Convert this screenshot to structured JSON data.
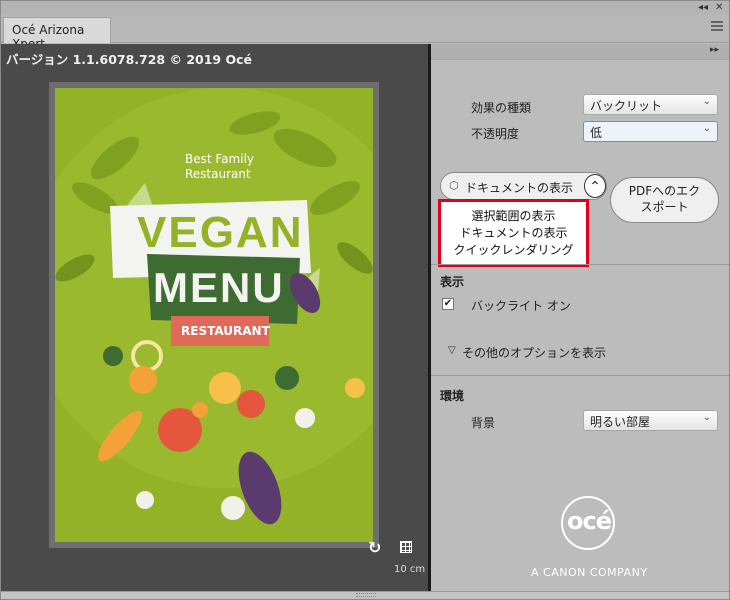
{
  "app": {
    "tab_title": "Océ Arizona Xpert"
  },
  "viewer": {
    "version": "バージョン 1.1.6078.728 © 2019 Océ",
    "scale_label": "10 cm",
    "poster": {
      "line1": "Best Family",
      "line2": "Restaurant",
      "title1": "VEGAN",
      "title2": "MENU",
      "badge": "RESTAURANT"
    }
  },
  "panel": {
    "effect_type_label": "効果の種類",
    "effect_type_value": "バックリット",
    "opacity_label": "不透明度",
    "opacity_value": "低",
    "view_mode_value": "ドキュメントの表示",
    "view_mode_options": [
      "選択範囲の表示",
      "ドキュメントの表示",
      "クイックレンダリング"
    ],
    "export_pdf_label": "PDFへのエクスポート",
    "export_pdf_line1": "PDFへのエク",
    "export_pdf_line2": "スポート",
    "display_section": "表示",
    "backlight_label": "バックライト オン",
    "backlight_checked": true,
    "more_options": "その他のオプションを表示",
    "environment_section": "環境",
    "background_label": "背景",
    "background_value": "明るい部屋"
  },
  "brand": {
    "logo": "océ",
    "tagline": "A CANON COMPANY"
  },
  "colors": {
    "poster_bg": "#93b228",
    "highlight": "#e0001b",
    "dark_green": "#3e6b32",
    "badge": "#e06a5a"
  }
}
